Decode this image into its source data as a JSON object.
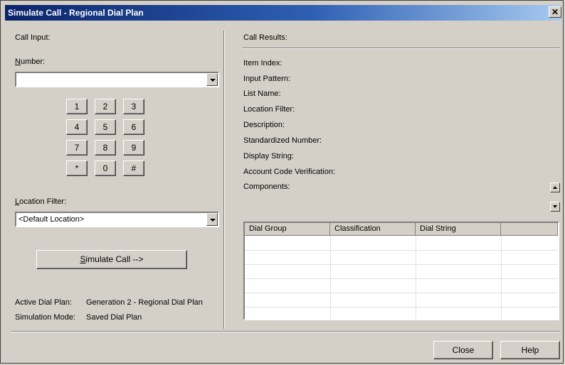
{
  "window": {
    "title": "Simulate Call - Regional Dial Plan",
    "close_glyph": "✕"
  },
  "call_input": {
    "heading": "Call Input:",
    "number_label_mnemonic": "N",
    "number_label_rest": "umber:",
    "number_value": "",
    "keypad": [
      "1",
      "2",
      "3",
      "4",
      "5",
      "6",
      "7",
      "8",
      "9",
      "*",
      "0",
      "#"
    ],
    "location_label_mnemonic": "L",
    "location_label_rest": "ocation Filter:",
    "location_value": "<Default Location>",
    "simulate_mnemonic": "S",
    "simulate_rest": "imulate Call -->",
    "active_dial_plan_label": "Active Dial Plan:",
    "active_dial_plan_value": "Generation 2 - Regional Dial Plan",
    "simulation_mode_label": "Simulation Mode:",
    "simulation_mode_value": "Saved Dial Plan"
  },
  "call_results": {
    "heading": "Call Results:",
    "fields": [
      "Item Index:",
      "Input Pattern:",
      "List Name:",
      "Location Filter:",
      "Description:",
      "Standardized Number:",
      "Display String:",
      "Account Code Verification:",
      "Components:"
    ],
    "table_headers": [
      "Dial Group",
      "Classification",
      "Dial String",
      ""
    ]
  },
  "footer": {
    "close_label": "Close",
    "help_label": "Help"
  },
  "colors": {
    "face": "#d4d0c8",
    "title_start": "#0a246a",
    "title_end": "#a6caf0"
  }
}
